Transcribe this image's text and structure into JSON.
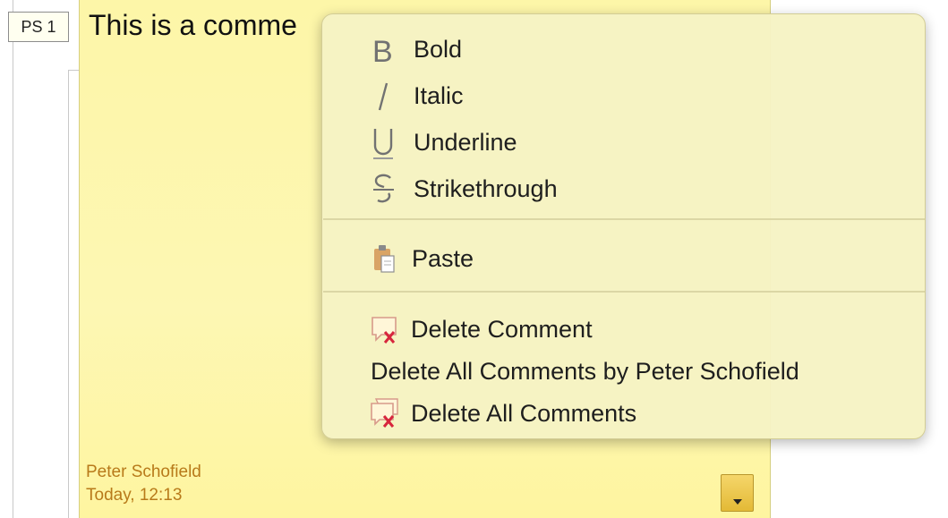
{
  "anchor": {
    "label": "PS 1"
  },
  "comment": {
    "text": "This is a comme",
    "author": "Peter Schofield",
    "date": "Today, 12:13",
    "note_color": "#fdf6a8",
    "meta_color": "#b87a1a"
  },
  "context_menu": {
    "format_items": [
      {
        "label": "Bold",
        "icon": "bold-icon"
      },
      {
        "label": "Italic",
        "icon": "italic-icon"
      },
      {
        "label": "Underline",
        "icon": "underline-icon"
      },
      {
        "label": "Strikethrough",
        "icon": "strikethrough-icon"
      }
    ],
    "paste": {
      "label": "Paste",
      "icon": "paste-icon"
    },
    "delete_items": [
      {
        "label": "Delete Comment",
        "icon": "delete-comment-icon"
      },
      {
        "label": "Delete All Comments by Peter Schofield",
        "icon": ""
      },
      {
        "label": "Delete All Comments",
        "icon": "delete-all-comments-icon"
      }
    ]
  }
}
